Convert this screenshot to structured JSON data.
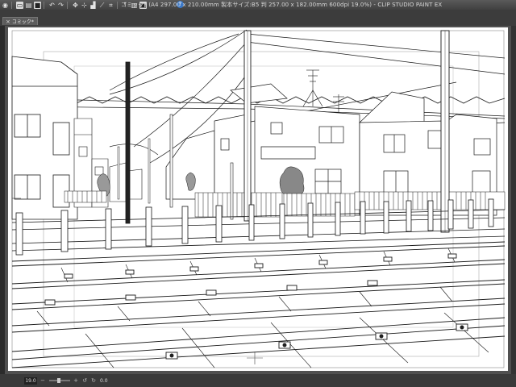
{
  "window": {
    "title": "コミック* (A4 297.00 x 210.00mm 製本サイズ:B5 判 257.00 x 182.00mm 600dpi 19.0%) - CLIP STUDIO PAINT EX"
  },
  "toolbar": {
    "icons": [
      "clip-studio-logo-icon",
      "new-icon",
      "open-icon",
      "save-icon",
      "undo-icon",
      "redo-icon",
      "transform-icon",
      "snap-icon",
      "ruler-icon",
      "perspective-icon",
      "grid-icon",
      "crop-icon",
      "layer-icon",
      "help-icon"
    ]
  },
  "tab": {
    "label": "コミック*",
    "close": "×"
  },
  "statusbar": {
    "zoom": "19.0",
    "angle": "0.0"
  },
  "colors": {
    "chrome_dark": "#2b2b2b",
    "canvas_bg": "#505050",
    "paper": "#ffffff",
    "ink": "#1a1a1a"
  }
}
